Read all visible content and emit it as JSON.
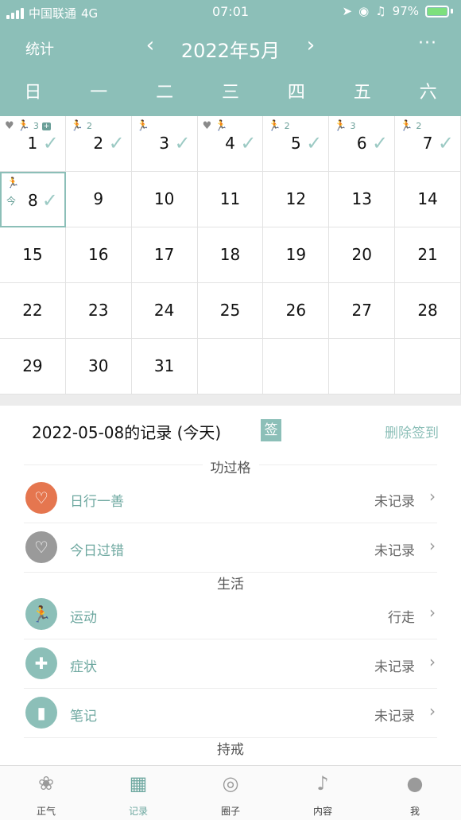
{
  "status_bar": {
    "carrier": "中国联通",
    "network": "4G",
    "time": "07:01",
    "battery": "97%"
  },
  "header": {
    "stats_label": "统计",
    "prev_icon": "chevron-left-icon",
    "month_title": "2022年5月",
    "next_icon": "chevron-right-icon",
    "more_label": "···",
    "accent_color": "#8cbfb8"
  },
  "weekdays": [
    "日",
    "一",
    "二",
    "三",
    "四",
    "五",
    "六"
  ],
  "calendar": {
    "days": [
      {
        "num": "1",
        "heart": true,
        "run": true,
        "run_count": "3",
        "med": true,
        "checked": true
      },
      {
        "num": "2",
        "run": true,
        "run_count": "2",
        "checked": true
      },
      {
        "num": "3",
        "run": true,
        "run_count": "",
        "checked": true
      },
      {
        "num": "4",
        "heart": true,
        "run": true,
        "run_count": "",
        "checked": true
      },
      {
        "num": "5",
        "run": true,
        "run_count": "2",
        "checked": true
      },
      {
        "num": "6",
        "run": true,
        "run_count": "3",
        "checked": true
      },
      {
        "num": "7",
        "run": true,
        "run_count": "2",
        "checked": true
      },
      {
        "num": "8",
        "run": true,
        "run_count": "",
        "checked": true,
        "today": true,
        "today_label": "今"
      },
      {
        "num": "9"
      },
      {
        "num": "10"
      },
      {
        "num": "11"
      },
      {
        "num": "12"
      },
      {
        "num": "13"
      },
      {
        "num": "14"
      },
      {
        "num": "15"
      },
      {
        "num": "16"
      },
      {
        "num": "17"
      },
      {
        "num": "18"
      },
      {
        "num": "19"
      },
      {
        "num": "20"
      },
      {
        "num": "21"
      },
      {
        "num": "22"
      },
      {
        "num": "23"
      },
      {
        "num": "24"
      },
      {
        "num": "25"
      },
      {
        "num": "26"
      },
      {
        "num": "27"
      },
      {
        "num": "28"
      },
      {
        "num": "29"
      },
      {
        "num": "30"
      },
      {
        "num": "31"
      },
      {
        "num": ""
      },
      {
        "num": ""
      },
      {
        "num": ""
      },
      {
        "num": ""
      }
    ]
  },
  "records": {
    "title": "2022-05-08的记录 (今天)",
    "sign_badge": "签",
    "delete_label": "删除签到",
    "sections": {
      "merit": "功过格",
      "life": "生活",
      "precepts": "持戒"
    },
    "rows": [
      {
        "label": "日行一善",
        "value": "未记录",
        "icon": "heart-icon",
        "color": "#e5764f"
      },
      {
        "label": "今日过错",
        "value": "未记录",
        "icon": "broken-heart-icon",
        "color": "#9a9a9a"
      },
      {
        "label": "运动",
        "value": "行走",
        "icon": "running-icon",
        "color": "#8cbfb8"
      },
      {
        "label": "症状",
        "value": "未记录",
        "icon": "medical-kit-icon",
        "color": "#8cbfb8"
      },
      {
        "label": "笔记",
        "value": "未记录",
        "icon": "notebook-icon",
        "color": "#8cbfb8"
      }
    ],
    "chevron": "›"
  },
  "tabbar": {
    "tabs": [
      {
        "label": "正气",
        "icon": "lotus-icon"
      },
      {
        "label": "记录",
        "icon": "calendar-icon",
        "active": true
      },
      {
        "label": "圈子",
        "icon": "circle-icon"
      },
      {
        "label": "内容",
        "icon": "music-note-icon"
      },
      {
        "label": "我",
        "icon": "person-icon"
      }
    ]
  }
}
